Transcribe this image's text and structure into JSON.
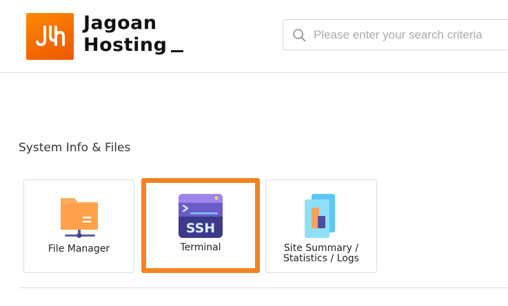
{
  "header": {
    "logo": {
      "line1": "Jagoan",
      "line2": "Hosting"
    },
    "search": {
      "placeholder": "Please enter your search criteria",
      "value": ""
    }
  },
  "section": {
    "title": "System Info & Files",
    "tiles": [
      {
        "label": "File Manager",
        "icon": "folder-icon"
      },
      {
        "label": "Terminal",
        "icon": "ssh-terminal-icon",
        "selected": true,
        "highlight_color": "#f58220"
      },
      {
        "label_line1": "Site Summary /",
        "label_line2": "Statistics / Logs",
        "icon": "site-summary-icon"
      }
    ]
  },
  "colors": {
    "brand": "#f46b00",
    "highlight": "#f58220"
  }
}
